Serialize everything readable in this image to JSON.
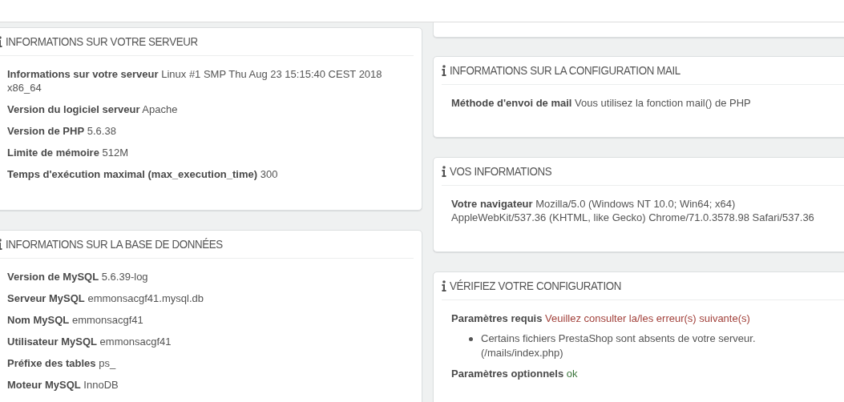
{
  "left_panels": [
    {
      "title": "INFORMATIONS SUR VOTRE SERVEUR",
      "rows": [
        {
          "label": "Informations sur votre serveur",
          "value": "Linux #1 SMP Thu Aug 23 15:15:40 CEST 2018 x86_64"
        },
        {
          "label": "Version du logiciel serveur",
          "value": "Apache"
        },
        {
          "label": "Version de PHP",
          "value": "5.6.38"
        },
        {
          "label": "Limite de mémoire",
          "value": "512M"
        },
        {
          "label": "Temps d'exécution maximal (max_execution_time)",
          "value": "300"
        }
      ]
    },
    {
      "title": "INFORMATIONS SUR LA BASE DE DONNÉES",
      "rows": [
        {
          "label": "Version de MySQL",
          "value": "5.6.39-log"
        },
        {
          "label": "Serveur MySQL",
          "value": "emmonsacgf41.mysql.db"
        },
        {
          "label": "Nom MySQL",
          "value": "emmonsacgf41"
        },
        {
          "label": "Utilisateur MySQL",
          "value": "emmonsacgf41"
        },
        {
          "label": "Préfixe des tables",
          "value": "ps_"
        },
        {
          "label": "Moteur MySQL",
          "value": "InnoDB"
        }
      ]
    }
  ],
  "right_panels": [
    {
      "title": "INFORMATIONS SUR LA CONFIGURATION MAIL",
      "rows": [
        {
          "label": "Méthode d'envoi de mail",
          "value": "Vous utilisez la fonction mail() de PHP"
        }
      ]
    },
    {
      "title": "VOS INFORMATIONS",
      "rows": [
        {
          "label": "Votre navigateur",
          "value": "Mozilla/5.0 (Windows NT 10.0; Win64; x64) AppleWebKit/537.36 (KHTML, like Gecko) Chrome/71.0.3578.98 Safari/537.36"
        }
      ]
    },
    {
      "title": "VÉRIFIEZ VOTRE CONFIGURATION",
      "rows": [
        {
          "label": "Paramètres requis",
          "value": "Veuillez consulter la/les erreur(s) suivante(s)",
          "color": "#a2413b",
          "items": [
            "Certains fichiers PrestaShop sont absents de votre serveur. (/mails/index.php)"
          ]
        },
        {
          "label": "Paramètres optionnels",
          "value": "ok",
          "color": "#3c763d"
        }
      ]
    }
  ]
}
